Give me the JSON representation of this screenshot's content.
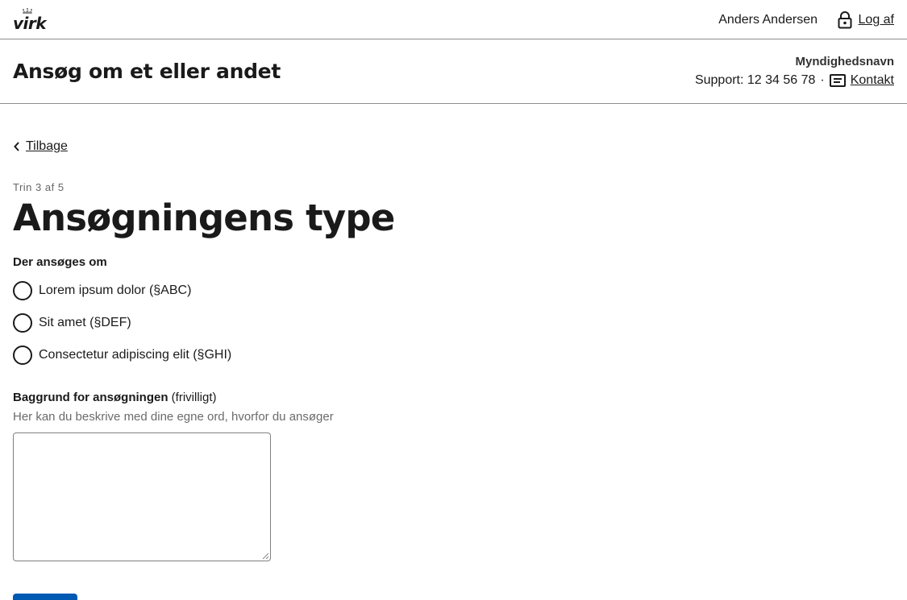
{
  "header": {
    "logo_text": "virk",
    "user_name": "Anders Andersen",
    "logout_label": "Log af"
  },
  "app": {
    "title": "Ansøg om et eller andet",
    "authority": "Myndighedsnavn",
    "support_text": "Support: 12 34 56 78",
    "separator": "·",
    "contact_label": "Kontakt"
  },
  "nav": {
    "back_label": "Tilbage"
  },
  "page": {
    "step": "Trin 3 af 5",
    "title": "Ansøgningens type"
  },
  "form": {
    "legend": "Der ansøges om",
    "options": [
      {
        "label": "Lorem ipsum dolor (§ABC)",
        "selected": false
      },
      {
        "label": "Sit amet (§DEF)",
        "selected": false
      },
      {
        "label": "Consectetur adipiscing elit (§GHI)",
        "selected": false
      }
    ],
    "textarea": {
      "label": "Baggrund for ansøgningen",
      "optional": "(frivilligt)",
      "hint": "Her kan du beskrive med dine egne ord, hvorfor du ansøger",
      "value": ""
    }
  },
  "colors": {
    "primary_button": "#0059b3",
    "text": "#1a1a1a",
    "border": "#8c8c8c"
  }
}
